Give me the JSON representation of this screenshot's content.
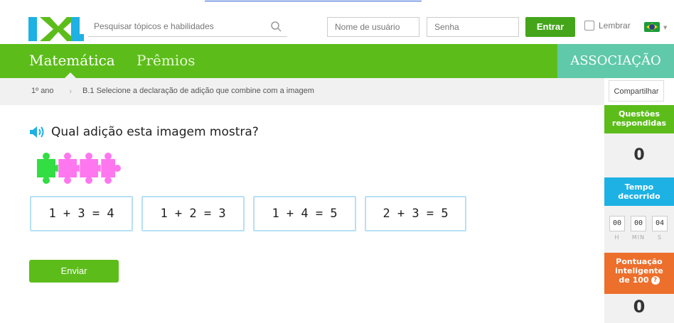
{
  "topbar": {
    "search_placeholder": "Pesquisar tópicos e habilidades",
    "username_placeholder": "Nome de usuário",
    "password_placeholder": "Senha",
    "login_label": "Entrar",
    "remember_label": "Lembrar",
    "logo_text": "IXL"
  },
  "nav": {
    "math": "Matemática",
    "prizes": "Prêmios",
    "association": "ASSOCIAÇÃO"
  },
  "breadcrumb": {
    "grade": "1º ano",
    "skill": "B.1 Selecione a declaração de adição que combine com a imagem",
    "share": "Compartilhar"
  },
  "question": {
    "text": "Qual adição esta imagem mostra?",
    "choices": [
      "1 + 3 = 4",
      "1 + 2 = 3",
      "1 + 4 = 5",
      "2 + 3 = 5"
    ],
    "submit": "Enviar",
    "puzzle_colors": [
      "#33dd44",
      "#ff77ee",
      "#ff77ee",
      "#ff77ee"
    ]
  },
  "sidebar": {
    "answered_label": "Questões respondidas",
    "answered_value": "0",
    "time_label": "Tempo decorrido",
    "timer": {
      "h": "00",
      "m": "00",
      "s": "04"
    },
    "timer_labels": {
      "h": "H",
      "m": "MIN",
      "s": "S"
    },
    "score_label": "Pontuação inteligente",
    "score_sub": "de 100",
    "score_value": "0"
  },
  "colors": {
    "green": "#5cbd1a",
    "teal": "#5fc9a9",
    "blue": "#1db1e4",
    "orange": "#ec6f2c"
  }
}
